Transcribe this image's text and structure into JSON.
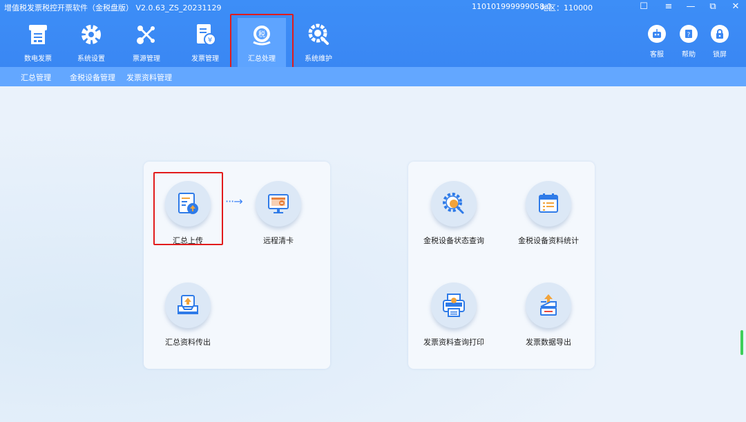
{
  "window": {
    "title": "增值税发票税控开票软件（金税盘版） V2.0.63_ZS_20231129",
    "tax_id": "110101999999058.0",
    "region": "地区：110000",
    "controls": [
      "☐",
      "≡",
      "—",
      "⧉",
      "✕"
    ]
  },
  "toolbar": {
    "items": [
      {
        "label": "数电发票",
        "icon": "receipt-icon"
      },
      {
        "label": "系统设置",
        "icon": "gear-icon"
      },
      {
        "label": "票源管理",
        "icon": "network-icon"
      },
      {
        "label": "发票管理",
        "icon": "invoice-icon"
      },
      {
        "label": "汇总处理",
        "icon": "tax-summary-icon",
        "active": true
      },
      {
        "label": "系统维护",
        "icon": "maintenance-icon"
      }
    ],
    "right": [
      {
        "label": "客服",
        "icon": "robot-icon"
      },
      {
        "label": "帮助",
        "icon": "help-icon"
      },
      {
        "label": "锁屏",
        "icon": "lock-icon"
      }
    ]
  },
  "submenu": [
    "汇总管理",
    "金税设备管理",
    "发票资料管理"
  ],
  "left_panel": {
    "items": [
      "汇总上传",
      "远程清卡",
      "汇总资料传出"
    ],
    "arrow": "···→"
  },
  "right_panel": {
    "items": [
      "金税设备状态查询",
      "金税设备资料统计",
      "发票资料查询打印",
      "发票数据导出"
    ]
  },
  "colors": {
    "accent": "#3a87f3",
    "submenu": "#63a7ff",
    "highlight": "#e21b1b",
    "icon_blue": "#2f7be8"
  }
}
